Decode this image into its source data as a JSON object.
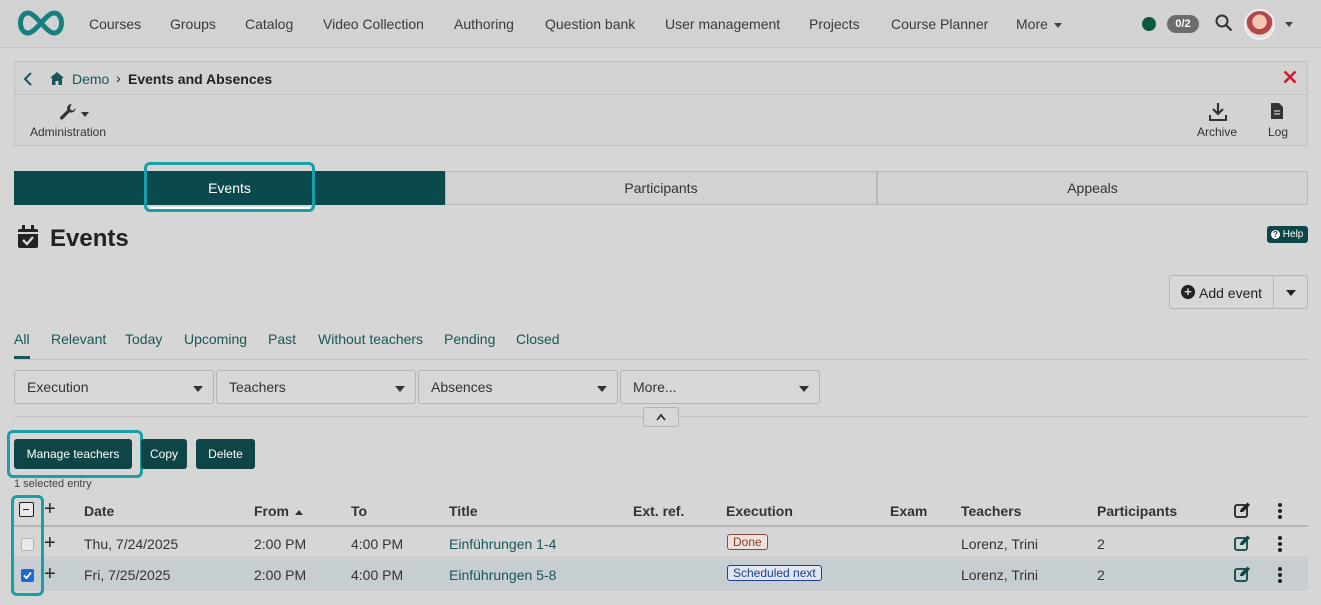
{
  "nav": {
    "items": [
      "Courses",
      "Groups",
      "Catalog",
      "Video Collection",
      "Authoring",
      "Question bank",
      "User management",
      "Projects",
      "Course Planner",
      "More"
    ],
    "counter": "0/2"
  },
  "course": {
    "breadcrumb_home": "Demo",
    "breadcrumb_current": "Events and Absences",
    "admin_label": "Administration",
    "archive_label": "Archive",
    "log_label": "Log"
  },
  "tabs": [
    "Events",
    "Participants",
    "Appeals"
  ],
  "page": {
    "title": "Events",
    "help_label": "Help",
    "add_event_label": "Add event"
  },
  "filters": {
    "tabs": [
      "All",
      "Relevant",
      "Today",
      "Upcoming",
      "Past",
      "Without teachers",
      "Pending",
      "Closed"
    ],
    "selects": [
      "Execution",
      "Teachers",
      "Absences",
      "More..."
    ]
  },
  "bulk": {
    "manage_teachers": "Manage teachers",
    "copy": "Copy",
    "delete": "Delete",
    "selected_text": "1 selected entry"
  },
  "table": {
    "headers": [
      "Date",
      "From",
      "To",
      "Title",
      "Ext. ref.",
      "Execution",
      "Exam",
      "Teachers",
      "Participants"
    ],
    "rows": [
      {
        "checked": false,
        "date": "Thu, 7/24/2025",
        "from": "2:00 PM",
        "to": "4:00 PM",
        "title": "Einführungen 1-4",
        "execution": "Done",
        "teachers": "Lorenz, Trini",
        "participants": "2"
      },
      {
        "checked": true,
        "date": "Fri, 7/25/2025",
        "from": "2:00 PM",
        "to": "4:00 PM",
        "title": "Einführungen 5-8",
        "execution": "Scheduled next",
        "teachers": "Lorenz, Trini",
        "participants": "2"
      }
    ]
  },
  "colors": {
    "accent": "#0b4a4c",
    "highlight": "#19a0a6",
    "link": "#17575a",
    "close_red": "#d0192c"
  }
}
